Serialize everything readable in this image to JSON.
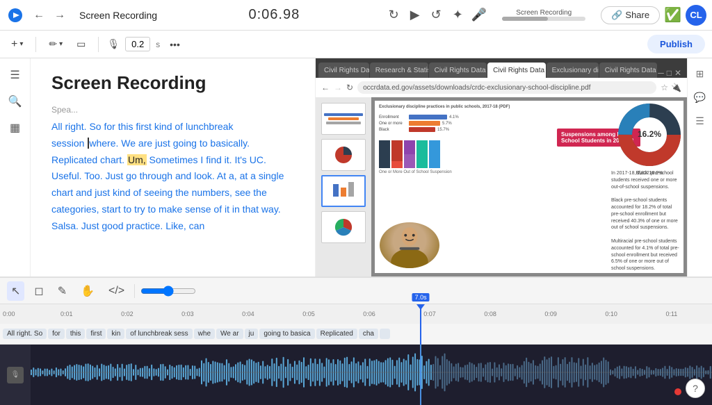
{
  "app": {
    "logo": "camtasia-logo",
    "title": "Screen Recording",
    "timer": "0:06.98",
    "avatar_initials": "CL"
  },
  "toolbar2": {
    "add_label": "+",
    "pen_label": "✏",
    "shape_label": "▭",
    "audio_level": "0.2",
    "more_label": "...",
    "publish_label": "Publish"
  },
  "left_sidebar": {
    "items": [
      {
        "name": "menu",
        "icon": "☰"
      },
      {
        "name": "search",
        "icon": "🔍"
      },
      {
        "name": "layers",
        "icon": "⧉"
      }
    ]
  },
  "text_panel": {
    "title": "Screen Recording",
    "speaker": "Spea...",
    "transcript": "All right. So for this first kind of lunchbreak session where. We are just going to basically. Replicated chart. Um, Sometimes I find it. It's UC. Useful. Too. Just go through and look. At a, at a single chart and just kind of seeing the numbers, see the categories, start to try to make sense of it in that way. Salsa. Just good practice. Like, can"
  },
  "browser": {
    "tabs": [
      {
        "label": "Civil Rights Data...",
        "active": false
      },
      {
        "label": "Research & Statistic...",
        "active": false
      },
      {
        "label": "Civil Rights Data Co...",
        "active": false
      },
      {
        "label": "Civil Rights Data Co...",
        "active": true
      },
      {
        "label": "Exclusionary disc...",
        "active": false
      },
      {
        "label": "Civil Rights Data Co...",
        "active": false
      }
    ],
    "address": "occrdata.ed.gov/assets/downloads/crdc-exclusionary-school-discipline.pdf",
    "pdf_title": "Exclusionary discipline practices in public schools, 2017-18 (PDF)"
  },
  "timeline": {
    "tools": [
      {
        "name": "select",
        "icon": "↖",
        "active": true
      },
      {
        "name": "trim",
        "icon": "◻",
        "active": false
      },
      {
        "name": "pen",
        "icon": "✎",
        "active": false
      },
      {
        "name": "hand",
        "icon": "✋",
        "active": false
      },
      {
        "name": "code",
        "icon": "</>",
        "active": false
      }
    ],
    "time_marks": [
      "0:00",
      "0:01",
      "0:02",
      "0:03",
      "0:04",
      "0:05",
      "0:06",
      "0:07",
      "0:08",
      "0:09",
      "0:10",
      "0:11"
    ],
    "playhead_time": "7.0s",
    "captions": [
      {
        "text": "All right. So",
        "active": false
      },
      {
        "text": "for",
        "active": false
      },
      {
        "text": "this",
        "active": false
      },
      {
        "text": "first",
        "active": false
      },
      {
        "text": "kin",
        "active": false
      },
      {
        "text": "of lunchbreak sess",
        "active": false
      },
      {
        "text": "whe",
        "active": false
      },
      {
        "text": "We ar",
        "active": false
      },
      {
        "text": "ju",
        "active": false
      },
      {
        "text": "going to basica",
        "active": false
      },
      {
        "text": "Replicated",
        "active": false
      },
      {
        "text": "cha",
        "active": false
      },
      {
        "text": "",
        "active": false
      }
    ]
  },
  "right_panel": {
    "icons": [
      "⊞",
      "💬",
      "⊟"
    ]
  },
  "colors": {
    "accent": "#2563eb",
    "brand": "#1a73e8",
    "waveform": "#8ecdf7",
    "waveform_active": "#4a90e2"
  }
}
